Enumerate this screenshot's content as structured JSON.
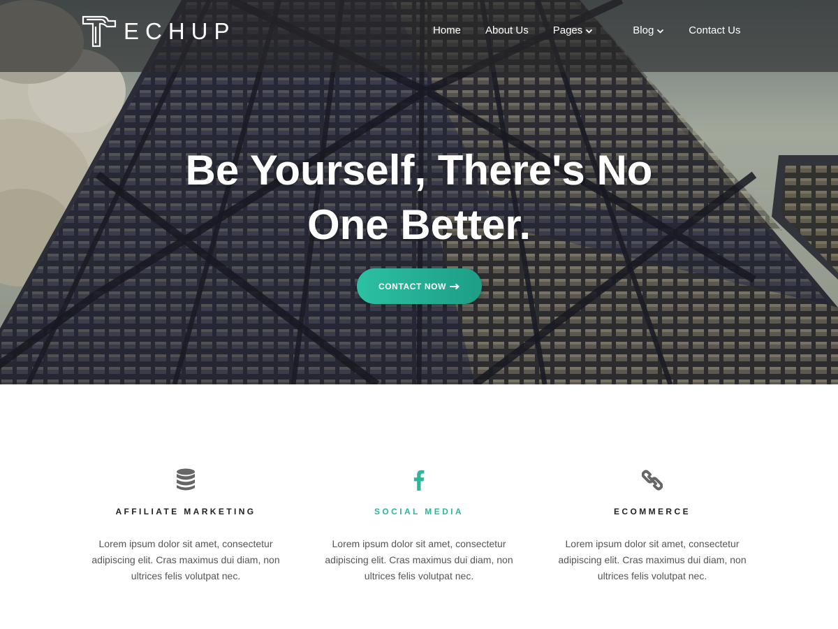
{
  "brand": {
    "logo_text": "ECHUP",
    "logo_icon": "stylized-t-logo"
  },
  "nav": {
    "items": [
      {
        "label": "Home",
        "has_dropdown": false
      },
      {
        "label": "About Us",
        "has_dropdown": false
      },
      {
        "label": "Pages",
        "has_dropdown": true
      },
      {
        "label": "Blog",
        "has_dropdown": true
      },
      {
        "label": "Contact Us",
        "has_dropdown": false
      }
    ],
    "dropdown_icon": "chevron-down-icon"
  },
  "hero": {
    "title_line1": "Be Yourself, There's No",
    "title_line2": "One Better.",
    "cta_label": "CONTACT NOW",
    "cta_icon": "arrow-right-icon"
  },
  "features": [
    {
      "icon": "database-icon",
      "title": "AFFILIATE MARKETING",
      "text": "Lorem ipsum dolor sit amet, consectetur adipiscing elit. Cras maximus dui diam, non ultrices felis volutpat nec."
    },
    {
      "icon": "facebook-icon",
      "title": "SOCIAL MEDIA",
      "text": "Lorem ipsum dolor sit amet, consectetur adipiscing elit. Cras maximus dui diam, non ultrices felis volutpat nec."
    },
    {
      "icon": "link-icon",
      "title": "ECOMMERCE",
      "text": "Lorem ipsum dolor sit amet, consectetur adipiscing elit. Cras maximus dui diam, non ultrices felis volutpat nec."
    }
  ],
  "colors": {
    "accent": "#2cb79a",
    "cta_gradient_start": "#2cc0a2",
    "cta_gradient_end": "#1d9e86",
    "icon_gray": "#666666",
    "text_gray": "#555555"
  }
}
